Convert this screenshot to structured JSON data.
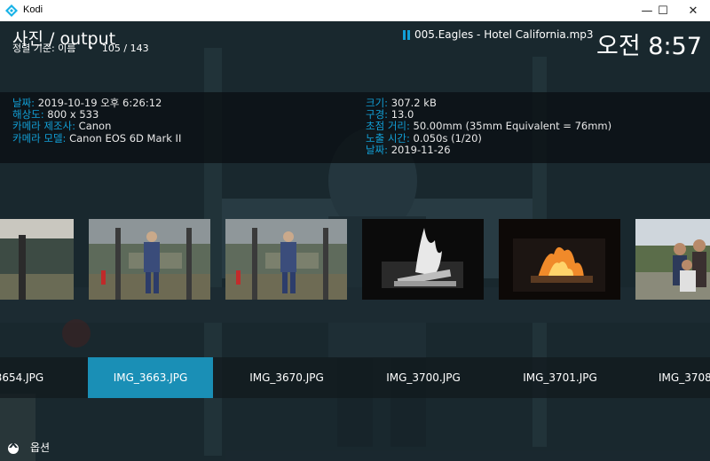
{
  "window": {
    "title": "Kodi",
    "minimize": "—",
    "maximize": "☐",
    "close": "✕"
  },
  "header": {
    "title": "사진 / output",
    "sort_label": "정렬 기준: 이름",
    "bullet": "•",
    "position": "105 / 143",
    "now_playing": "005.Eagles - Hotel California.mp3",
    "clock": "오전 8:57"
  },
  "info_left": [
    {
      "label": "날짜:",
      "value": "2019-10-19 오후 6:26:12"
    },
    {
      "label": "해상도:",
      "value": "800 x 533"
    },
    {
      "label": "카메라 제조사:",
      "value": "Canon"
    },
    {
      "label": "카메라 모델:",
      "value": "Canon EOS 6D Mark II"
    }
  ],
  "info_right": [
    {
      "label": "크기:",
      "value": "307.2 kB"
    },
    {
      "label": "구경:",
      "value": "13.0"
    },
    {
      "label": "초점 거리:",
      "value": "50.00mm  (35mm Equivalent = 76mm)"
    },
    {
      "label": "노출 시간:",
      "value": "0.050s (1/20)"
    },
    {
      "label": "날짜:",
      "value": "2019-11-26"
    }
  ],
  "files": [
    "3654.JPG",
    "IMG_3663.JPG",
    "IMG_3670.JPG",
    "IMG_3700.JPG",
    "IMG_3701.JPG",
    "IMG_3708"
  ],
  "selected_file": "IMG_3663.JPG",
  "options_label": "옵션",
  "colors": {
    "accent": "#12a0d7",
    "selected": "#1a8fb6"
  }
}
